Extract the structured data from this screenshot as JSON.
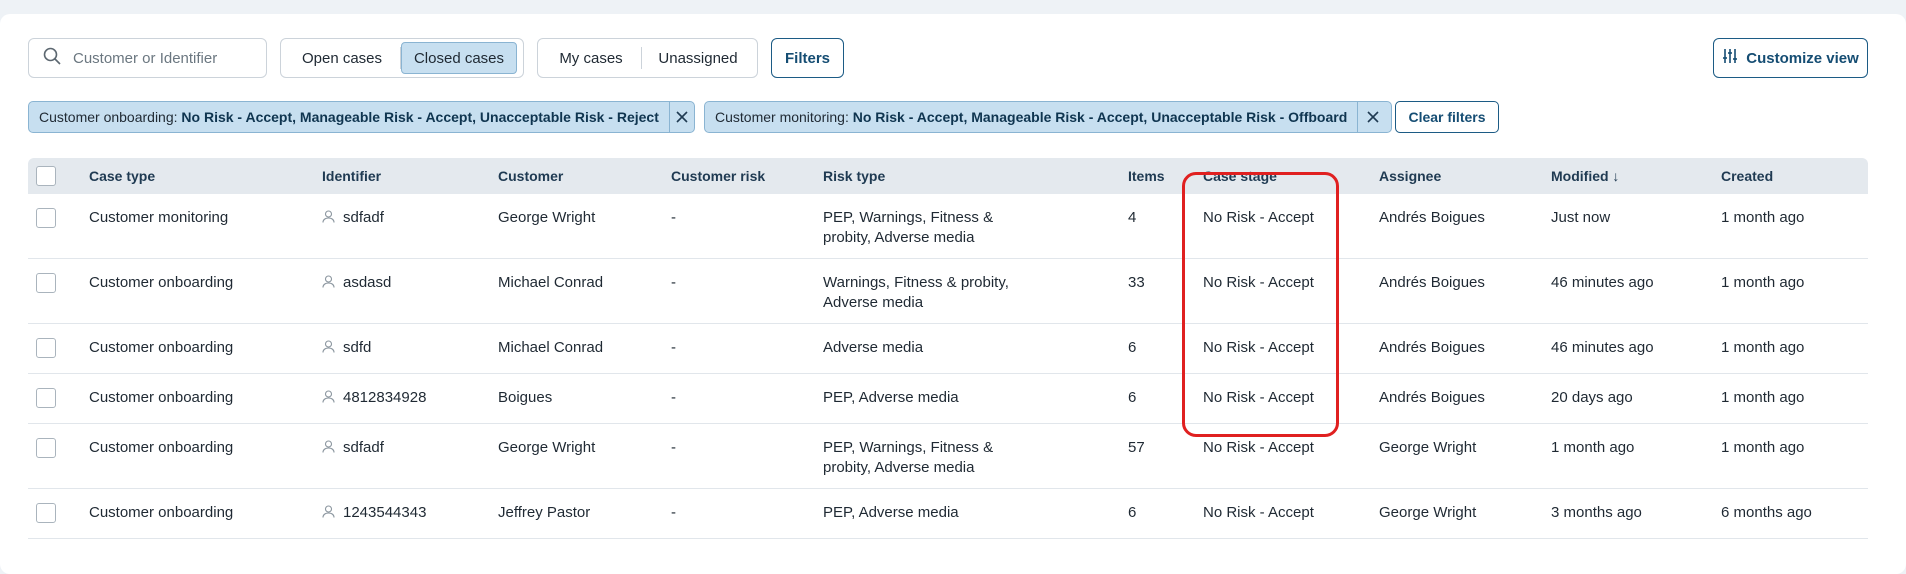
{
  "toolbar": {
    "search_placeholder": "Customer or Identifier",
    "case_toggle": {
      "open": "Open cases",
      "closed": "Closed cases",
      "active": "closed"
    },
    "assign_toggle": {
      "mine": "My cases",
      "unassigned": "Unassigned"
    },
    "filters_label": "Filters",
    "customize_label": "Customize view"
  },
  "active_filters": [
    {
      "name": "Customer onboarding:",
      "values": "No Risk - Accept, Manageable Risk - Accept, Unacceptable Risk - Reject"
    },
    {
      "name": "Customer monitoring:",
      "values": "No Risk - Accept, Manageable Risk - Accept, Unacceptable Risk - Offboard"
    }
  ],
  "clear_filters_label": "Clear filters",
  "table": {
    "columns": {
      "case_type": "Case type",
      "identifier": "Identifier",
      "customer": "Customer",
      "customer_risk": "Customer risk",
      "risk_type": "Risk type",
      "items": "Items",
      "case_stage": "Case stage",
      "assignee": "Assignee",
      "modified": "Modified ↓",
      "created": "Created"
    },
    "rows": [
      {
        "case_type": "Customer monitoring",
        "identifier": "sdfadf",
        "customer": "George Wright",
        "customer_risk": "-",
        "risk_type": "PEP, Warnings, Fitness & probity, Adverse media",
        "items": "4",
        "case_stage": "No Risk - Accept",
        "assignee": "Andrés Boigues",
        "modified": "Just now",
        "created": "1 month ago"
      },
      {
        "case_type": "Customer onboarding",
        "identifier": "asdasd",
        "customer": "Michael Conrad",
        "customer_risk": "-",
        "risk_type": "Warnings, Fitness & probity, Adverse media",
        "items": "33",
        "case_stage": "No Risk - Accept",
        "assignee": "Andrés Boigues",
        "modified": "46 minutes ago",
        "created": "1 month ago"
      },
      {
        "case_type": "Customer onboarding",
        "identifier": "sdfd",
        "customer": "Michael Conrad",
        "customer_risk": "-",
        "risk_type": "Adverse media",
        "items": "6",
        "case_stage": "No Risk - Accept",
        "assignee": "Andrés Boigues",
        "modified": "46 minutes ago",
        "created": "1 month ago"
      },
      {
        "case_type": "Customer onboarding",
        "identifier": "4812834928",
        "customer": "Boigues",
        "customer_risk": "-",
        "risk_type": "PEP, Adverse media",
        "items": "6",
        "case_stage": "No Risk - Accept",
        "assignee": "Andrés Boigues",
        "modified": "20 days ago",
        "created": "1 month ago"
      },
      {
        "case_type": "Customer onboarding",
        "identifier": "sdfadf",
        "customer": "George Wright",
        "customer_risk": "-",
        "risk_type": "PEP, Warnings, Fitness & probity, Adverse media",
        "items": "57",
        "case_stage": "No Risk - Accept",
        "assignee": "George Wright",
        "modified": "1 month ago",
        "created": "1 month ago"
      },
      {
        "case_type": "Customer onboarding",
        "identifier": "1243544343",
        "customer": "Jeffrey Pastor",
        "customer_risk": "-",
        "risk_type": "PEP, Adverse media",
        "items": "6",
        "case_stage": "No Risk - Accept",
        "assignee": "George Wright",
        "modified": "3 months ago",
        "created": "6 months ago"
      }
    ]
  },
  "colors": {
    "accent": "#154d73",
    "chip_bg": "#c7dff0",
    "highlight": "#e02020"
  }
}
